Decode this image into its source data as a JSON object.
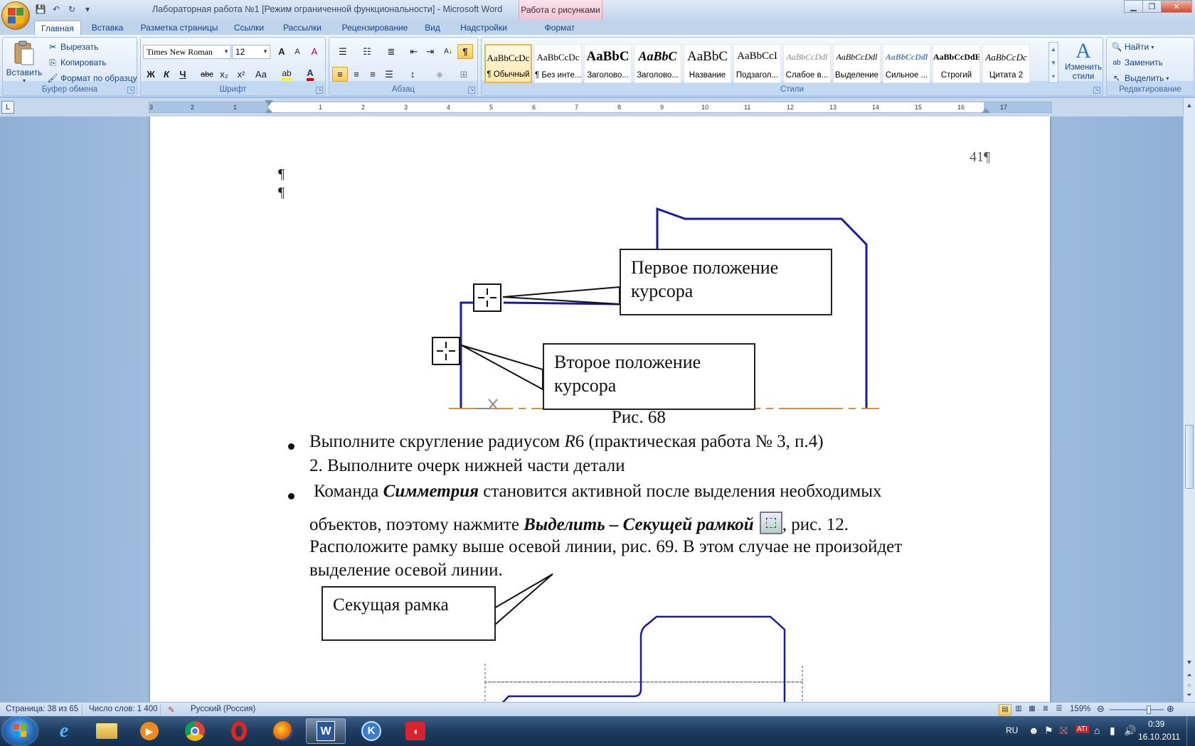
{
  "window": {
    "title": "Лабораторная  работа №1 [Режим ограниченной функциональности] - Microsoft Word",
    "context_tab_header": "Работа с рисунками",
    "controls": {
      "minimize": "▁",
      "maximize": "❐",
      "close": "✕"
    }
  },
  "qat": {
    "save": "💾",
    "undo": "↶",
    "redo": "↻",
    "more": "▾"
  },
  "tabs": [
    {
      "label": "Главная"
    },
    {
      "label": "Вставка"
    },
    {
      "label": "Разметка страницы"
    },
    {
      "label": "Ссылки"
    },
    {
      "label": "Рассылки"
    },
    {
      "label": "Рецензирование"
    },
    {
      "label": "Вид"
    },
    {
      "label": "Надстройки"
    },
    {
      "label": "Формат"
    }
  ],
  "ribbon": {
    "clipboard": {
      "group_label": "Буфер обмена",
      "paste": "Вставить",
      "cut": "Вырезать",
      "copy": "Копировать",
      "format_painter": "Формат по образцу"
    },
    "font": {
      "group_label": "Шрифт",
      "font_name": "Times New Roman",
      "font_size": "12",
      "bold": "Ж",
      "italic": "К",
      "underline": "Ч",
      "strike": "abc",
      "sub": "x₂",
      "sup": "x²",
      "case": "Aa",
      "grow": "A",
      "shrink": "A",
      "clear": "A"
    },
    "paragraph": {
      "group_label": "Абзац",
      "pilcrow": "¶",
      "sort": "A↓"
    },
    "styles": {
      "group_label": "Стили",
      "items": [
        {
          "sample": "AaBbCcDc",
          "name": "¶ Обычный"
        },
        {
          "sample": "AaBbCcDc",
          "name": "¶ Без инте..."
        },
        {
          "sample": "AaBbC",
          "name": "Заголово..."
        },
        {
          "sample": "AaBbC",
          "name": "Заголово..."
        },
        {
          "sample": "AaBbC",
          "name": "Название"
        },
        {
          "sample": "AaBbCcI",
          "name": "Подзагол..."
        },
        {
          "sample": "AaBbCcDdl",
          "name": "Слабое в..."
        },
        {
          "sample": "AaBbCcDdl",
          "name": "Выделение"
        },
        {
          "sample": "AaBbCcDdl",
          "name": "Сильное ..."
        },
        {
          "sample": "AaBbCcDdE",
          "name": "Строгий"
        },
        {
          "sample": "AaBbCcDc",
          "name": "Цитата 2"
        }
      ],
      "change_styles": "Изменить стили"
    },
    "editing": {
      "group_label": "Редактирование",
      "find": "Найти",
      "replace": "Заменить",
      "select": "Выделить"
    }
  },
  "ruler": {
    "corner": "L",
    "left_numbers": [
      "3",
      "2",
      "1"
    ],
    "right_numbers": [
      "1",
      "2",
      "3",
      "4",
      "5",
      "6",
      "7",
      "8",
      "9",
      "10",
      "11",
      "12",
      "13",
      "14",
      "15",
      "16",
      "17"
    ]
  },
  "document": {
    "page_number": "41¶",
    "empty_para_1": "¶",
    "empty_para_2": "¶",
    "callout_first": "Первое положение курсора",
    "callout_second": "Второе положение курсора",
    "caption_68": "Рис. 68",
    "list": {
      "item1_pre": "Выполните скругление радиусом ",
      "item1_r": "R",
      "item1_post": "6 (практическая работа № 3, п.4)",
      "item2": "2.  Выполните очерк нижней части  детали",
      "item3_a": "Команда ",
      "item3_b": "Симметрия",
      "item3_c": " становится активной после выделения необходимых",
      "item3_line2_a": "объектов, поэтому нажмите ",
      "item3_line2_b": "Выделить – Секущей рамкой",
      "item3_line2_c": ", рис. 12.",
      "item3_line3": "Расположите рамку выше осевой линии, рис. 69. В этом случае не произойдет",
      "item3_line4": "выделение осевой линии."
    },
    "callout_frame": "Секущая рамка"
  },
  "statusbar": {
    "page": "Страница: 38 из 65",
    "words": "Число слов: 1 400",
    "language": "Русский (Россия)",
    "zoom": "159%"
  },
  "taskbar": {
    "lang": "RU",
    "time": "0:39",
    "date": "16.10.2011"
  },
  "colors": {
    "accent": "#15428b",
    "drawing_blue": "#1a1aa0",
    "axis_orange": "#e08a3a"
  }
}
